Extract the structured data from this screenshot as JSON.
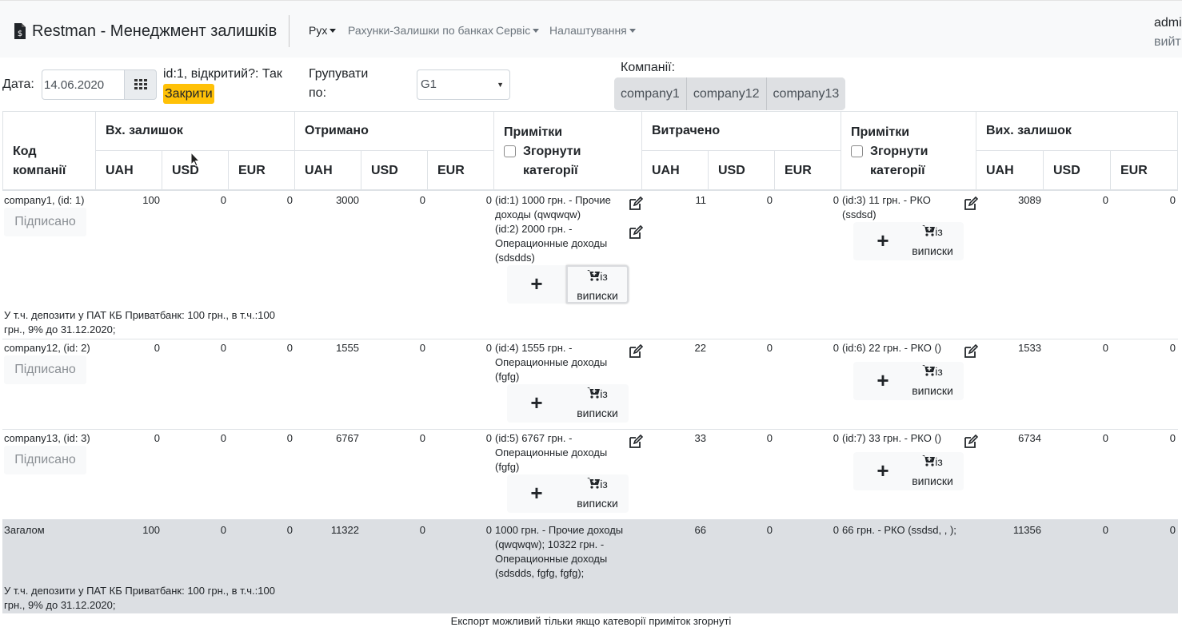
{
  "navbar": {
    "brand": "Restman - Менеджмент залишків",
    "menu": [
      "Рух",
      "Рахунки-Залишки по банках",
      "Сервіс",
      "Налаштування"
    ],
    "user": "admi",
    "logout": "вийт"
  },
  "filters": {
    "date_label": "Дата:",
    "date_value": "14.06.2020",
    "status_text": "id:1, відкритий?: Так",
    "close_label": "Закрити",
    "group_label_1": "Групувати",
    "group_label_2": "по:",
    "group_value": "G1",
    "companies_label": "Компанії:",
    "companies": [
      "company1",
      "company12",
      "company13"
    ]
  },
  "table": {
    "col_code_1": "Код",
    "col_code_2": "компанії",
    "col_in_balance": "Вх. залишок",
    "col_received": "Отримано",
    "col_notes": "Примітки",
    "col_spent": "Витрачено",
    "col_out_balance": "Вих. залишок",
    "collapse_label_1": "Згорнути",
    "collapse_label_2": "категорії",
    "currencies": [
      "UAH",
      "USD",
      "EUR"
    ],
    "signed_label": "Підписано",
    "plus_label": "+",
    "stmt_label_1": "із",
    "stmt_label_2": "виписки",
    "rows": [
      {
        "name": "company1, (id: 1)",
        "in": [
          "100",
          "0",
          "0"
        ],
        "rec": [
          "3000",
          "0",
          "0"
        ],
        "rec_notes": [
          "(id:1) 1000 грн. - Прочие",
          "доходы (qwqwqw)",
          "(id:2) 2000 грн. -",
          "Операционные доходы",
          "(sdsdds)"
        ],
        "spent": [
          "11",
          "0",
          "0"
        ],
        "spent_notes": [
          "(id:3) 11 грн. - РКО",
          "(ssdsd)"
        ],
        "out": [
          "3089",
          "0",
          "0"
        ],
        "deposit": [
          "У т.ч. депозити у ПАТ КБ Приватбанк: 100 грн., в т.ч.:100",
          "грн., 9% до 31.12.2020;"
        ]
      },
      {
        "name": "company12, (id: 2)",
        "in": [
          "0",
          "0",
          "0"
        ],
        "rec": [
          "1555",
          "0",
          "0"
        ],
        "rec_notes": [
          "(id:4) 1555 грн. -",
          "Операционные доходы",
          "(fgfg)"
        ],
        "spent": [
          "22",
          "0",
          "0"
        ],
        "spent_notes": [
          "(id:6) 22 грн. - РКО ()"
        ],
        "out": [
          "1533",
          "0",
          "0"
        ]
      },
      {
        "name": "company13, (id: 3)",
        "in": [
          "0",
          "0",
          "0"
        ],
        "rec": [
          "6767",
          "0",
          "0"
        ],
        "rec_notes": [
          "(id:5) 6767 грн. -",
          "Операционные доходы",
          "(fgfg)"
        ],
        "spent": [
          "33",
          "0",
          "0"
        ],
        "spent_notes": [
          "(id:7) 33 грн. - РКО ()"
        ],
        "out": [
          "6734",
          "0",
          "0"
        ]
      }
    ],
    "total": {
      "name": "Загалом",
      "in": [
        "100",
        "0",
        "0"
      ],
      "rec": [
        "11322",
        "0",
        "0"
      ],
      "rec_notes": [
        "1000 грн. - Прочие доходы",
        "(qwqwqw); 10322 грн. -",
        "Операционные доходы",
        "(sdsdds, fgfg, fgfg);"
      ],
      "spent": [
        "66",
        "0",
        "0"
      ],
      "spent_notes": [
        "66 грн. - РКО (ssdsd, , );"
      ],
      "out": [
        "11356",
        "0",
        "0"
      ],
      "deposit": [
        "У т.ч. депозити у ПАТ КБ Приватбанк: 100 грн., в т.ч.:100",
        "грн., 9% до 31.12.2020;"
      ]
    }
  },
  "footer_note": "Експорт можливий тільки якщо катеворії приміток згорнуті",
  "colors": {
    "navbar_bg": "#f8f9fa",
    "warning": "#ffc107",
    "total_bg": "#dcdfe3"
  }
}
